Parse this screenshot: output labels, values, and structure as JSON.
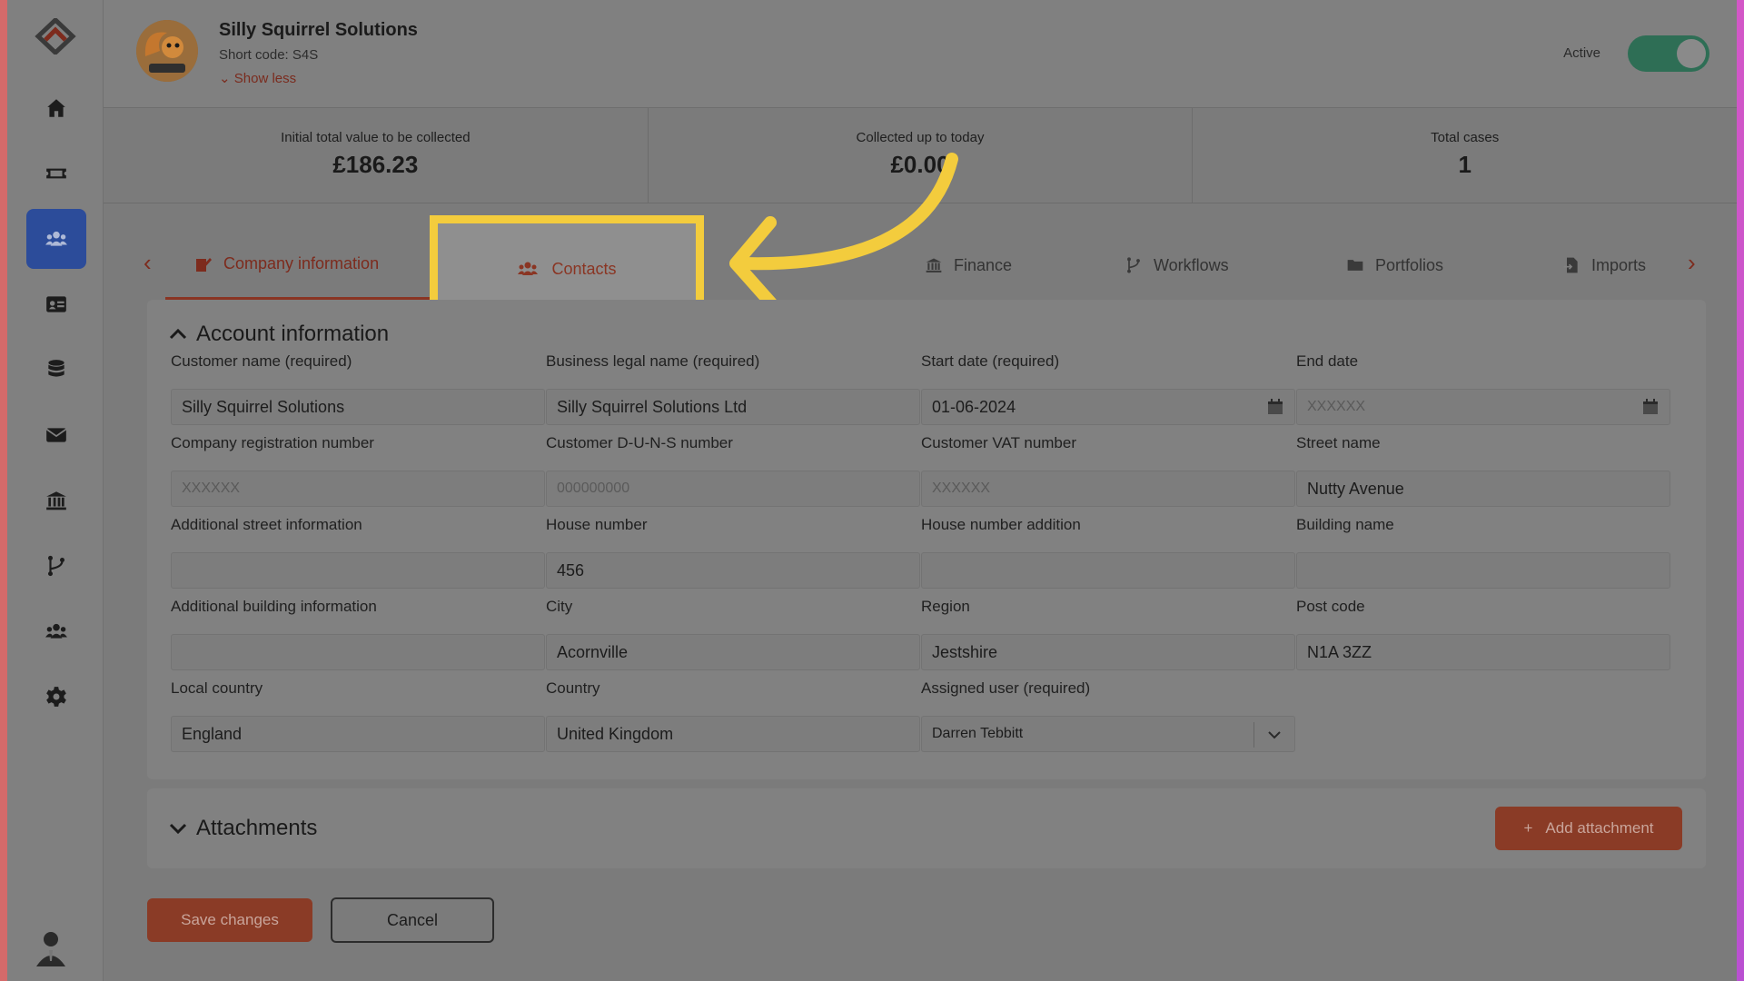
{
  "company": {
    "name": "Silly Squirrel Solutions",
    "short_code": "Short code: S4S",
    "show_less": "Show less",
    "status_label": "Active",
    "status_on": true
  },
  "stats": [
    {
      "label": "Initial total value to be collected",
      "value": "£186.23"
    },
    {
      "label": "Collected up to today",
      "value": "£0.00"
    },
    {
      "label": "Total cases",
      "value": "1"
    }
  ],
  "tabs": [
    {
      "label": "Company information",
      "icon": "edit-doc-icon",
      "selected": true
    },
    {
      "label": "Contacts",
      "icon": "users-icon",
      "selected": false
    },
    {
      "label": "Finance",
      "icon": "bank-icon",
      "selected": false
    },
    {
      "label": "Workflows",
      "icon": "branch-icon",
      "selected": false
    },
    {
      "label": "Portfolios",
      "icon": "folder-icon",
      "selected": false
    },
    {
      "label": "Imports",
      "icon": "import-icon",
      "selected": false
    }
  ],
  "account": {
    "title": "Account information",
    "fields": {
      "customer_name": {
        "label": "Customer name (required)",
        "value": "Silly Squirrel Solutions"
      },
      "legal_name": {
        "label": "Business legal name (required)",
        "value": "Silly Squirrel Solutions Ltd"
      },
      "start_date": {
        "label": "Start date (required)",
        "value": "01-06-2024"
      },
      "end_date": {
        "label": "End date",
        "placeholder": "XXXXXX"
      },
      "company_reg": {
        "label": "Company registration number",
        "placeholder": "XXXXXX"
      },
      "duns": {
        "label": "Customer D-U-N-S number",
        "placeholder": "000000000"
      },
      "vat": {
        "label": "Customer VAT number",
        "placeholder": "XXXXXX"
      },
      "street": {
        "label": "Street name",
        "value": "Nutty Avenue"
      },
      "add_street": {
        "label": "Additional street information",
        "value": ""
      },
      "house_number": {
        "label": "House number",
        "value": "456"
      },
      "house_addition": {
        "label": "House number addition",
        "value": ""
      },
      "building_name": {
        "label": "Building name",
        "value": ""
      },
      "add_building": {
        "label": "Additional building information",
        "value": ""
      },
      "city": {
        "label": "City",
        "value": "Acornville"
      },
      "region": {
        "label": "Region",
        "value": "Jestshire"
      },
      "post_code": {
        "label": "Post code",
        "value": "N1A 3ZZ"
      },
      "local_country": {
        "label": "Local country",
        "value": "England"
      },
      "country": {
        "label": "Country",
        "value": "United Kingdom"
      },
      "assigned_user": {
        "label": "Assigned user (required)",
        "value": "Darren Tebbitt"
      }
    }
  },
  "attachments": {
    "title": "Attachments",
    "add_label": "Add attachment"
  },
  "actions": {
    "save": "Save changes",
    "cancel": "Cancel"
  },
  "colors": {
    "accent": "#8a3b26",
    "highlight": "#f3cc3d",
    "nav_active": "#2c4c9a"
  }
}
